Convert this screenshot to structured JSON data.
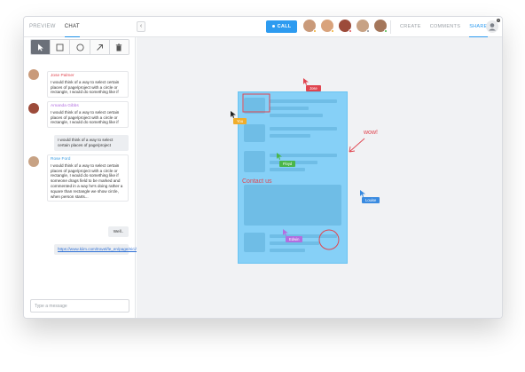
{
  "top": {
    "left_tabs": [
      "PREVIEW",
      "CHAT"
    ],
    "collapse_icon": "‹",
    "call_label": "CALL",
    "right_tabs": [
      "CREATE",
      "COMMENTS",
      "SHARE"
    ],
    "avatars": [
      {
        "status_color": "#f0ad2b",
        "skin": "#c99a7a"
      },
      {
        "status_color": "#f0ad2b",
        "skin": "#d9a37c"
      },
      {
        "status_color": "#e24f56",
        "skin": "#9c4b3a"
      },
      {
        "status_color": "#8a8f97",
        "skin": "#c7a284"
      },
      {
        "status_color": "#4ab64a",
        "skin": "#a4765a"
      }
    ],
    "user_badge": "×"
  },
  "toolbar": {
    "tools": [
      "cursor-icon",
      "square-icon",
      "circle-icon",
      "arrow-icon",
      "trash-icon"
    ]
  },
  "chat": {
    "messages": [
      {
        "name": "Jose Palmer",
        "name_color": "#e0454f",
        "text": "I would think of a way to select certain places of page/project with a circle or rectangle, I would do something like if"
      },
      {
        "name": "Amanda Gibbs",
        "name_color": "#b26de0",
        "text": "I would think of a way to select certain places of page/project with a circle or rectangle, I would do something like if"
      },
      {
        "mine": true,
        "text": "I would think of a way to select certain places of page/project"
      },
      {
        "name": "Rose Ford",
        "name_color": "#3a9be0",
        "text": "I would think of a way to select certain places of page/project with a circle or rectangle, I would do something like if someone drags field to be marked and commented in a way he's doing rather a square than rectangle we show circle, when person starts..."
      },
      {
        "mine": true,
        "text": "Well.."
      },
      {
        "mine": true,
        "link": "https://www.kiim.com/travel/le_en/page/eici/calendar.htm?"
      }
    ],
    "input_placeholder": "Type a message"
  },
  "canvas": {
    "annotation_wow": "wow!",
    "annotation_contact": "Contact us",
    "cursors": [
      {
        "label": "Jose",
        "color": "#e0454f"
      },
      {
        "label": "You",
        "color": "#f0ad2b"
      },
      {
        "label": "Floyd",
        "color": "#4ab64a"
      },
      {
        "label": "Louise",
        "color": "#3a8be0"
      },
      {
        "label": "Edwin",
        "color": "#b26de0"
      }
    ]
  }
}
